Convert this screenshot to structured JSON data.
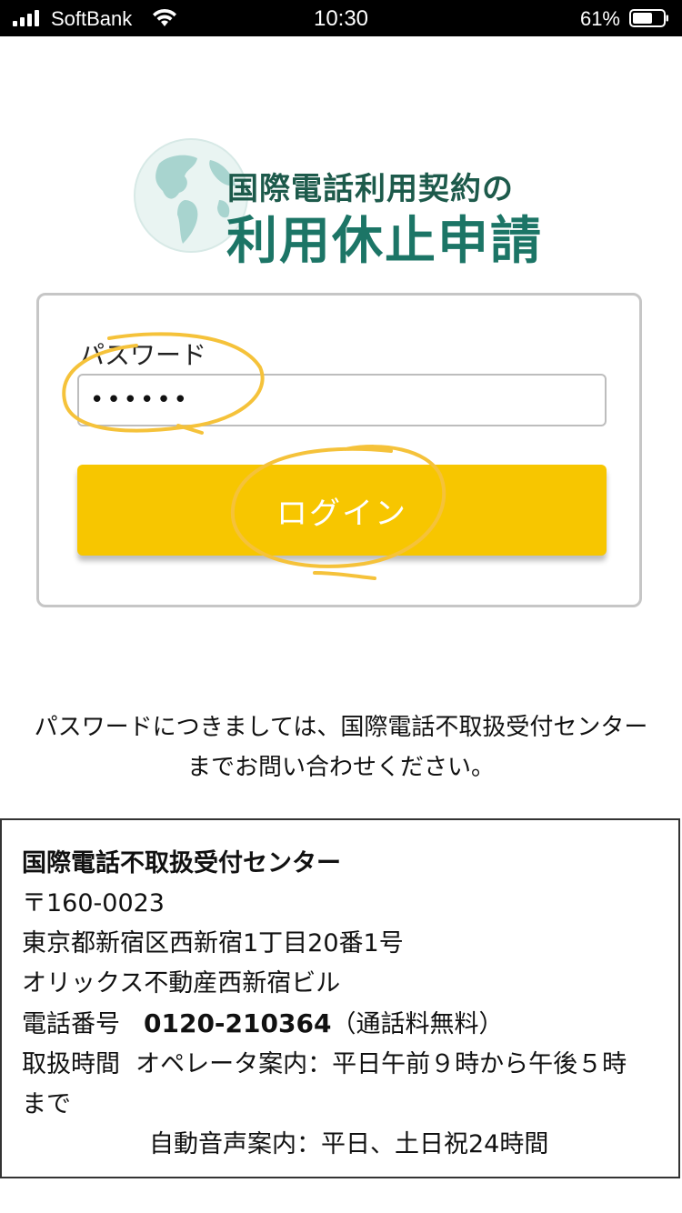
{
  "status_bar": {
    "carrier": "SoftBank",
    "time": "10:30",
    "battery": "61%"
  },
  "logo": {
    "line1": "国際電話利用契約の",
    "line2": "利用休止申請"
  },
  "login": {
    "password_label": "パスワード",
    "password_value": "••••••",
    "button_label": "ログイン"
  },
  "note": {
    "line1": "パスワードにつきましては、国際電話不取扱受付センター",
    "line2": "までお問い合わせください。"
  },
  "contact": {
    "title": "国際電話不取扱受付センター",
    "postal": "〒160-0023",
    "address": "東京都新宿区西新宿1丁目20番1号",
    "building": "オリックス不動産西新宿ビル",
    "phone_label": "電話番号",
    "phone_number": "0120-210364",
    "phone_note": "（通話料無料）",
    "hours_label": "取扱時間",
    "hours_operator": "オペレータ案内：平日午前９時から午後５時",
    "hours_operator_cont": "まで",
    "hours_auto": "自動音声案内：平日、土日祝24時間"
  },
  "colors": {
    "button": "#f7c600",
    "logo_dark": "#1d5a4b",
    "logo_teal": "#1c7566",
    "annotation": "#f5c23a"
  }
}
